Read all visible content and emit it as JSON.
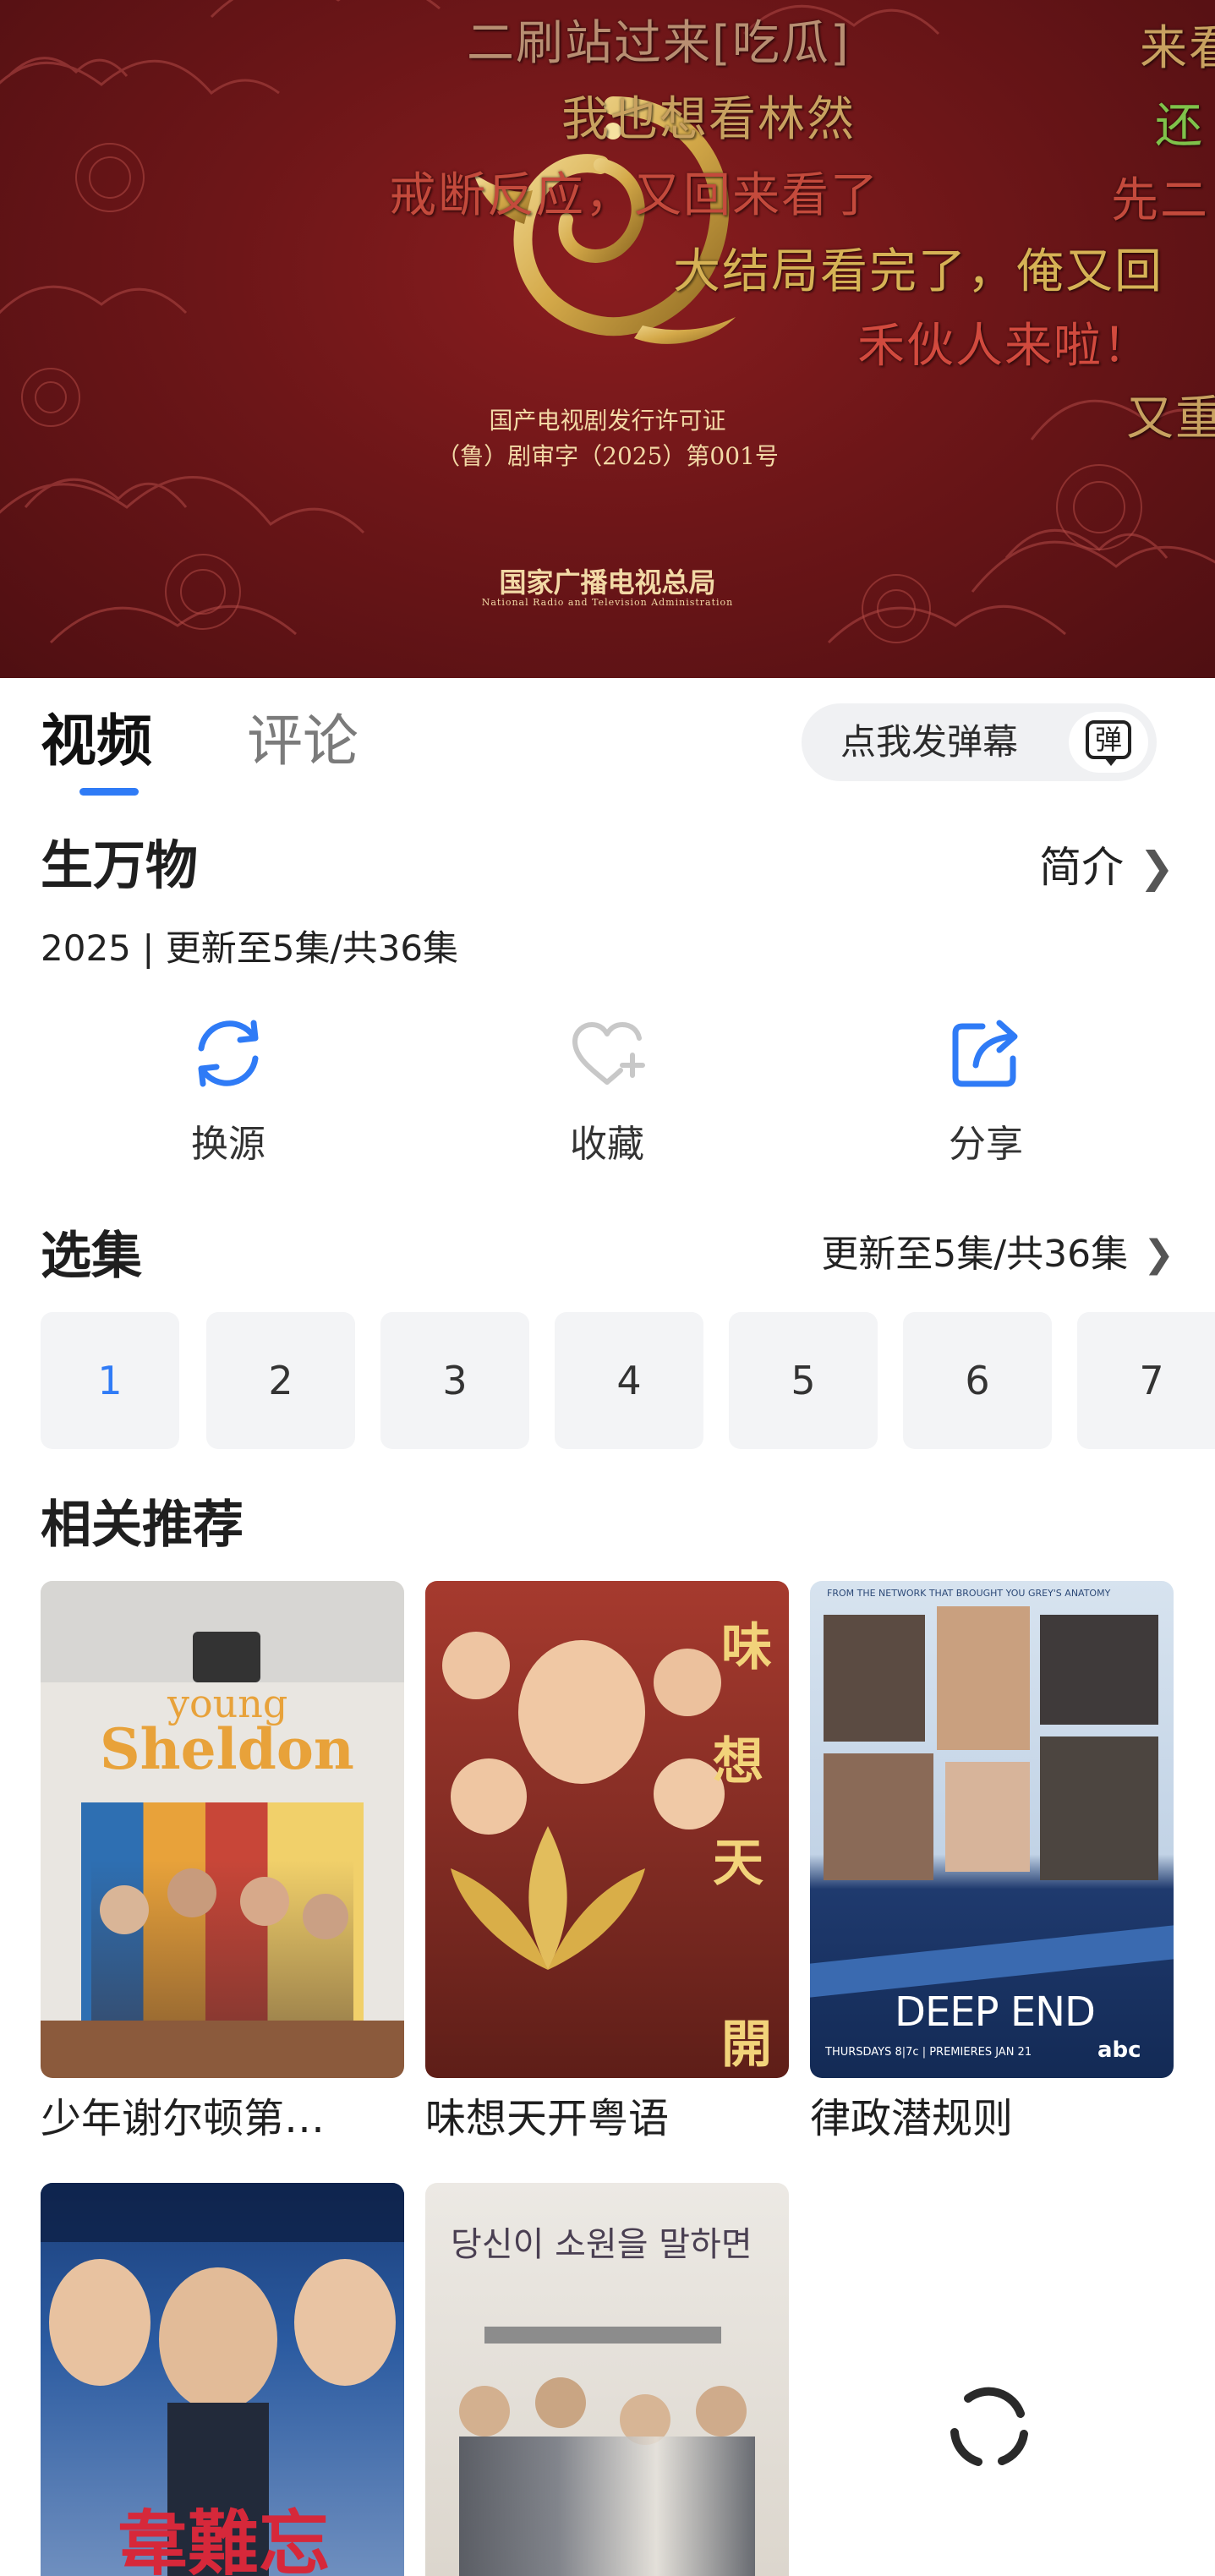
{
  "player": {
    "license_line1": "国产电视剧发行许可证",
    "license_line2": "（鲁）剧审字（2025）第001号",
    "agency_name": "国家广播电视总局",
    "agency_name_en": "National Radio and Television Administration",
    "danmaku": [
      {
        "text": "二刷站过来[吃瓜]",
        "color": "#b88e72"
      },
      {
        "text": "我也想看林然",
        "color": "#c8a160"
      },
      {
        "text": "戒断反应，又回来看了",
        "color": "#c44a3c"
      },
      {
        "text": "大结局看完了，俺又回",
        "color": "#d6b255"
      },
      {
        "text": "禾伙人来啦！",
        "color": "#d24a3e"
      },
      {
        "text": "来看",
        "color": "#c8a160"
      },
      {
        "text": "还",
        "color": "#7fc24a"
      },
      {
        "text": "先二",
        "color": "#c44a3c"
      },
      {
        "text": "又重",
        "color": "#c8a160"
      }
    ]
  },
  "tabs": {
    "video": "视频",
    "comments": "评论"
  },
  "danmaku_input": {
    "placeholder": "点我发弹幕",
    "toggle_label": "弹"
  },
  "show": {
    "title": "生万物",
    "intro_label": "简介",
    "meta": "2025 | 更新至5集/共36集"
  },
  "actions": [
    {
      "label": "换源",
      "icon": "refresh-icon"
    },
    {
      "label": "收藏",
      "icon": "heart-plus-icon"
    },
    {
      "label": "分享",
      "icon": "share-icon"
    }
  ],
  "episodes": {
    "title": "选集",
    "summary": "更新至5集/共36集",
    "items": [
      "1",
      "2",
      "3",
      "4",
      "5",
      "6",
      "7"
    ],
    "current": "1"
  },
  "recommendations": {
    "title": "相关推荐",
    "items": [
      {
        "title": "少年谢尔顿第…",
        "poster_text": [
          "young",
          "Sheldon"
        ]
      },
      {
        "title": "味想天开粤语",
        "poster_text": [
          "味",
          "想",
          "天",
          "開"
        ]
      },
      {
        "title": "律政潜规则",
        "poster_text": [
          "FROM THE NETWORK THAT BROUGHT YOU GREY'S ANATOMY",
          "DEEP END",
          "THURSDAYS 8|7c | PREMIERES JAN 21",
          "abc"
        ]
      },
      {
        "title": "",
        "poster_text": [
          "韋難忘"
        ]
      },
      {
        "title": "",
        "poster_text": [
          "당신이 소원을 말하면"
        ]
      }
    ]
  },
  "colors": {
    "accent": "#2f7bf6",
    "player_bg": "#6d1618",
    "chip_bg": "#f3f4f6"
  }
}
